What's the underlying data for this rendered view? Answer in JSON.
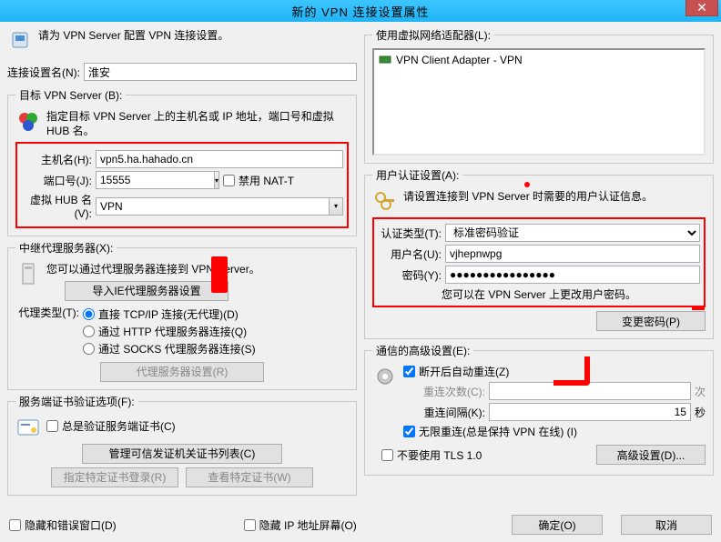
{
  "window": {
    "title": "新的 VPN 连接设置属性",
    "close": "✕"
  },
  "left": {
    "header": "请为 VPN Server 配置 VPN 连接设置。",
    "conn_name_label": "连接设置名(N):",
    "conn_name_value": "淮安",
    "target_legend": "目标 VPN Server (B):",
    "target_desc": "指定目标 VPN Server 上的主机名或 IP 地址，端口号和虚拟 HUB 名。",
    "host_label": "主机名(H):",
    "host_value": "vpn5.ha.hahado.cn",
    "port_label": "端口号(J):",
    "port_value": "15555",
    "disable_nat": "禁用 NAT-T",
    "hub_label": "虚拟 HUB 名(V):",
    "hub_value": "VPN",
    "proxy_legend": "中继代理服务器(X):",
    "proxy_desc": "您可以通过代理服务器连接到 VPN Server。",
    "import_ie": "导入IE代理服务器设置",
    "proxy_type_label": "代理类型(T):",
    "proxy_direct": "直接 TCP/IP 连接(无代理)(D)",
    "proxy_http": "通过 HTTP 代理服务器连接(Q)",
    "proxy_socks": "通过 SOCKS 代理服务器连接(S)",
    "proxy_settings_btn": "代理服务器设置(R)",
    "cert_legend": "服务端证书验证选项(F):",
    "cert_always": "总是验证服务端证书(C)",
    "cert_manage": "管理可信发证机关证书列表(C)",
    "cert_specify": "指定特定证书登录(R)",
    "cert_view": "查看特定证书(W)"
  },
  "right": {
    "adapter_legend": "使用虚拟网络适配器(L):",
    "adapter_item": "VPN Client Adapter - VPN",
    "auth_legend": "用户认证设置(A):",
    "auth_desc": "请设置连接到 VPN Server 时需要的用户认证信息。",
    "auth_type_label": "认证类型(T):",
    "auth_type_value": "标准密码验证",
    "user_label": "用户名(U):",
    "user_value": "vjhepnwpg",
    "pass_label": "密码(Y):",
    "pass_value": "●●●●●●●●●●●●●●●●",
    "pass_hint": "您可以在 VPN Server 上更改用户密码。",
    "change_pass": "变更密码(P)",
    "adv_legend": "通信的高级设置(E):",
    "auto_reconnect": "断开后自动重连(Z)",
    "retry_count_label": "重连次数(C):",
    "retry_count_value": "",
    "retry_count_unit": "次",
    "retry_interval_label": "重连间隔(K):",
    "retry_interval_value": "15",
    "retry_interval_unit": "秒",
    "infinite_retry": "无限重连(总是保持 VPN 在线) (I)",
    "no_tls10": "不要使用 TLS 1.0",
    "adv_settings_btn": "高级设置(D)..."
  },
  "footer": {
    "hide_err": "隐藏和错误窗口(D)",
    "hide_ip": "隐藏 IP 地址屏幕(O)",
    "ok": "确定(O)",
    "cancel": "取消"
  }
}
